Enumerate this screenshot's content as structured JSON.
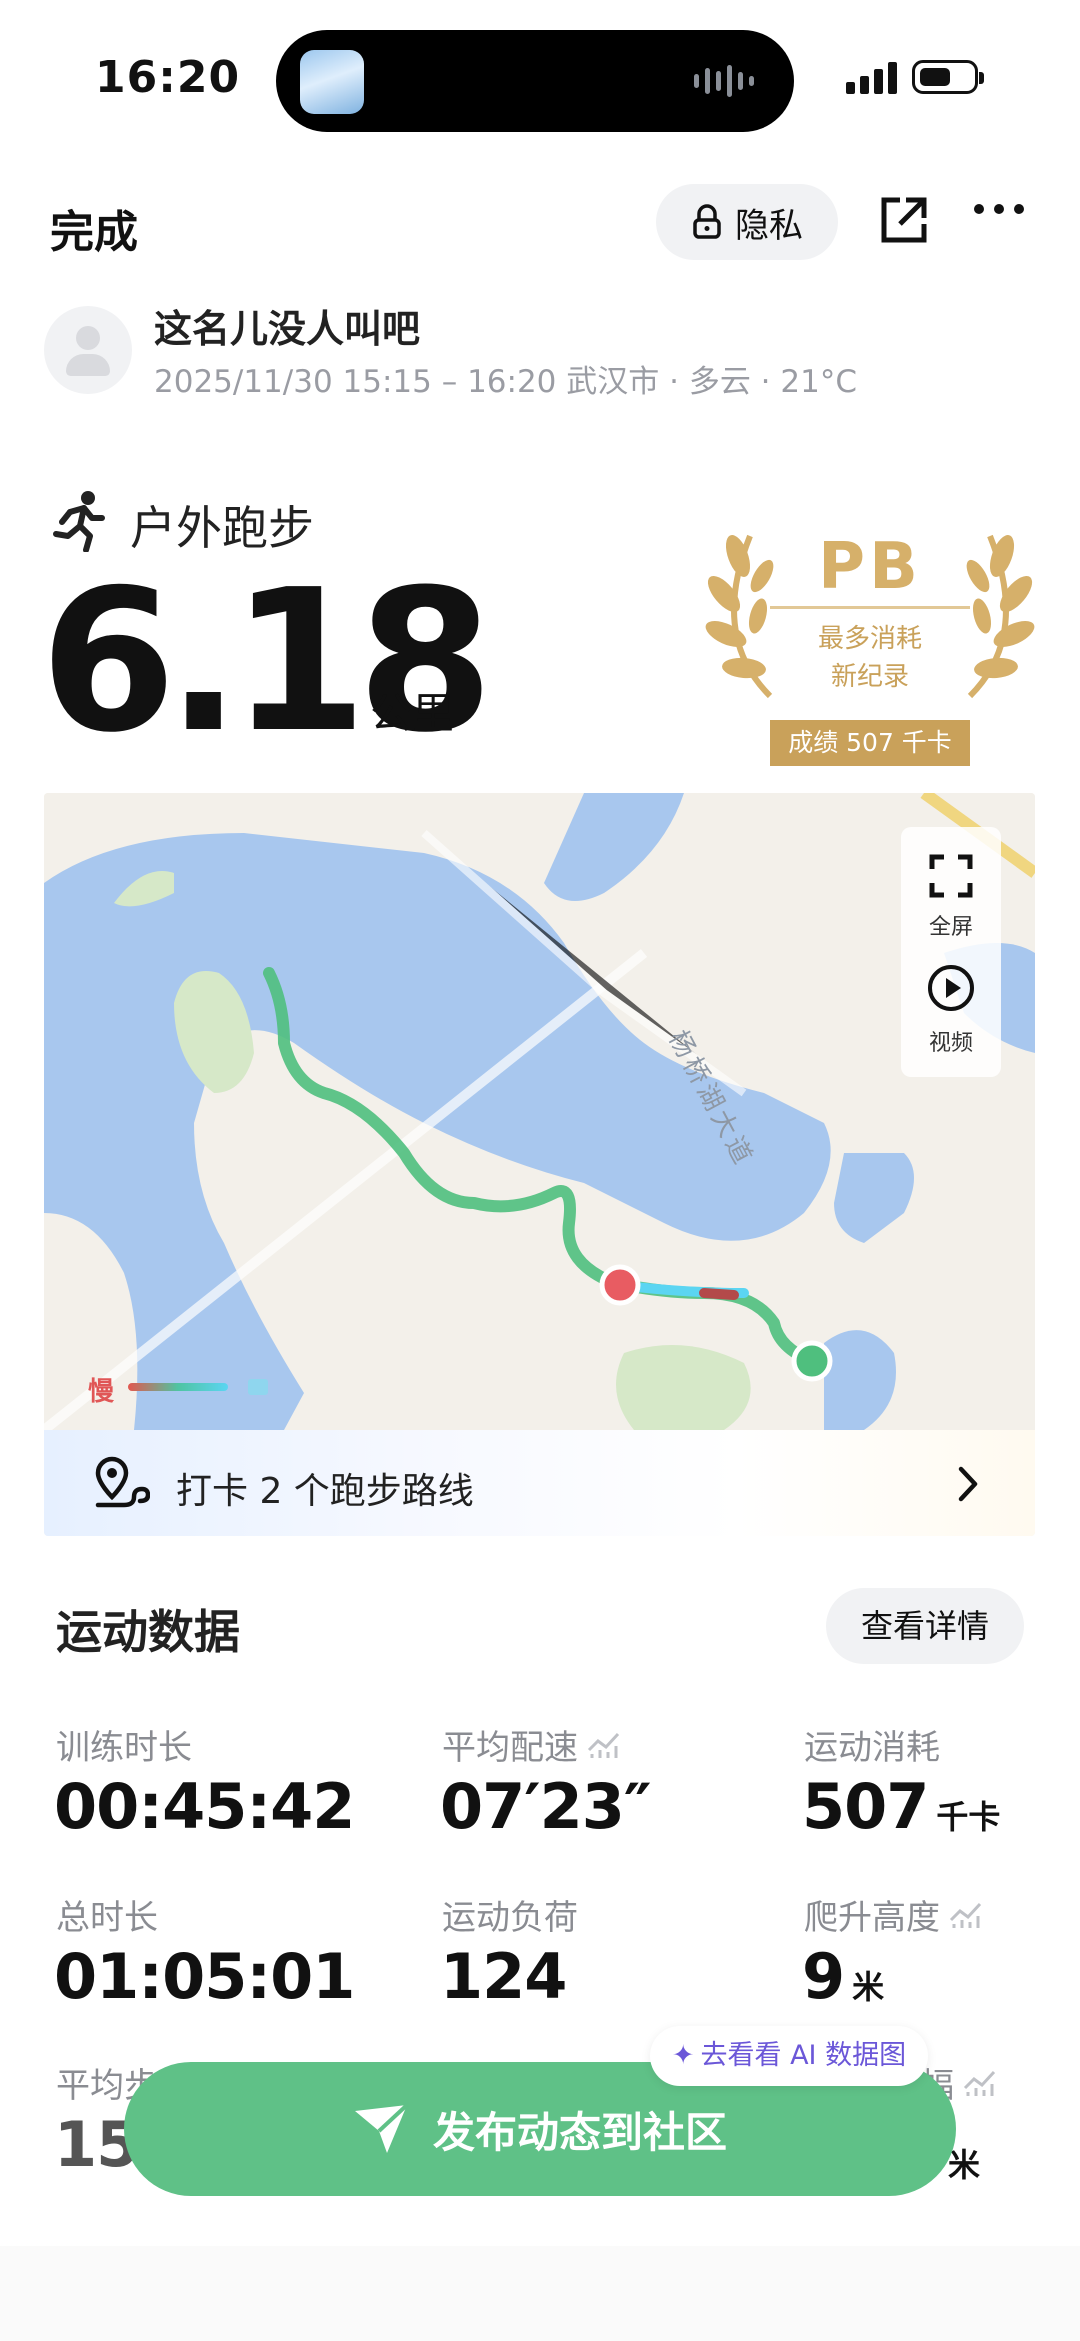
{
  "status_bar": {
    "time": "16:20"
  },
  "header": {
    "done_label": "完成",
    "privacy_label": "隐私"
  },
  "profile": {
    "username": "这名儿没人叫吧",
    "meta": "2025/11/30 15:15 – 16:20 武汉市 · 多云 · 21°C"
  },
  "activity": {
    "type": "户外跑步",
    "distance": "6.18",
    "distance_unit": "公里"
  },
  "badge": {
    "title": "PB",
    "line1": "最多消耗",
    "line2": "新纪录",
    "score": "成绩 507 千卡",
    "color": "#d6b06a"
  },
  "map": {
    "fullscreen_label": "全屏",
    "video_label": "视频",
    "road_label": "杨桥湖大道",
    "legend_slow": "慢",
    "route_colors": {
      "route": "#4fbf7e",
      "start": "#4fbf7e",
      "end": "#e85c62",
      "water": "#a8c7ee",
      "land": "#f3f0ea"
    }
  },
  "checkin": {
    "text": "打卡 2 个跑步路线"
  },
  "stats": {
    "title": "运动数据",
    "details_label": "查看详情",
    "items": [
      {
        "label": "训练时长",
        "value": "00:45:42",
        "unit": ""
      },
      {
        "label": "平均配速",
        "value": "07′23″",
        "unit": ""
      },
      {
        "label": "运动消耗",
        "value": "507",
        "unit": "千卡"
      },
      {
        "label": "总时长",
        "value": "01:05:01",
        "unit": ""
      },
      {
        "label": "运动负荷",
        "value": "124",
        "unit": ""
      },
      {
        "label": "爬升高度",
        "value": "9",
        "unit": "米"
      },
      {
        "label": "平均步",
        "value": "15",
        "unit": ""
      },
      {
        "label": "幅",
        "value": "",
        "unit": "米"
      }
    ]
  },
  "ai_chip": {
    "label": "去看看 AI 数据图"
  },
  "publish": {
    "label": "发布动态到社区"
  }
}
